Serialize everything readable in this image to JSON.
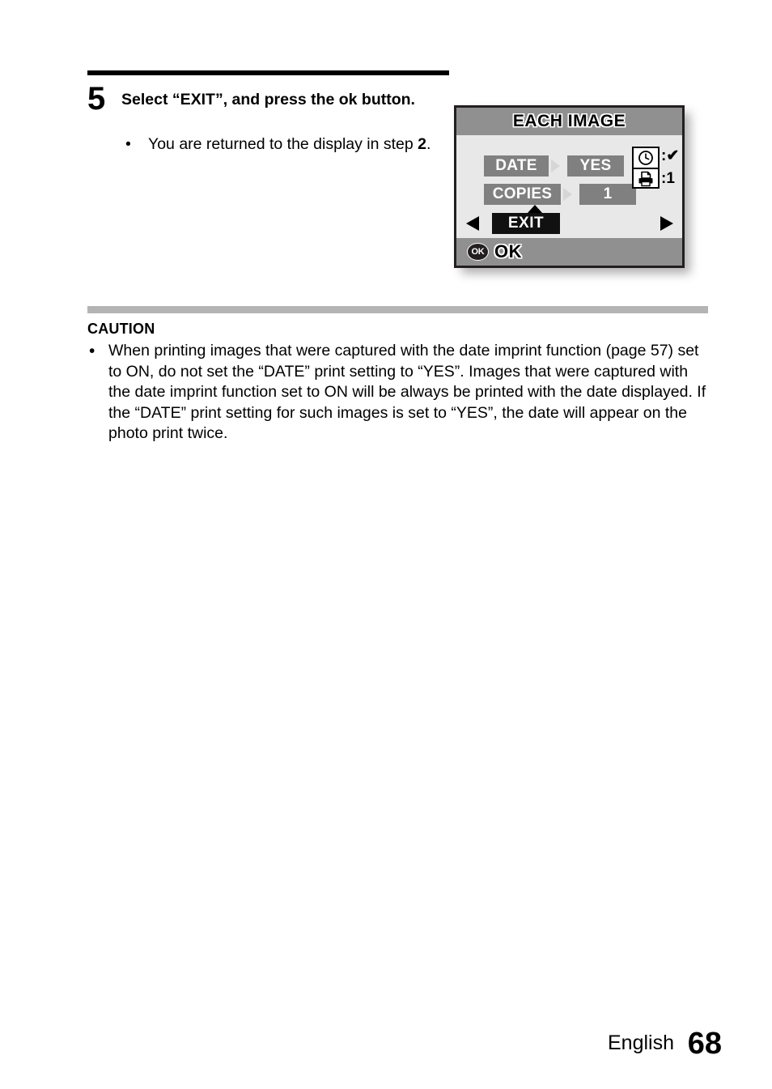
{
  "step": {
    "number": "5",
    "heading": "Select “EXIT”, and press the ok button.",
    "bullet_marker": "•",
    "bullet_text_before": "You are returned to the display in step ",
    "bullet_bold": "2",
    "bullet_text_after": "."
  },
  "lcd": {
    "title": "EACH IMAGE",
    "rows": [
      {
        "label": "DATE",
        "value": "YES",
        "arrow": "chip-arrow-right-icon"
      },
      {
        "label": "COPIES",
        "value": "1",
        "arrow": "chip-arrow-right-icon"
      }
    ],
    "exit_label": "EXIT",
    "left_arrow": "◀",
    "right_arrow": "▶",
    "up_caret": "▲",
    "status_icons": [
      {
        "icon": "clock-icon",
        "value": ":✔"
      },
      {
        "icon": "printer-icon",
        "value": ":1"
      }
    ],
    "footer_badge": "OK",
    "footer_label": "OK"
  },
  "caution": {
    "title": "CAUTION",
    "bullet_marker": "•",
    "text": "When printing images that were captured with the date imprint function (page 57) set to ON, do not set the “DATE” print setting to “YES”. Images that were captured with the date imprint function set to ON will be always be printed with the date displayed. If the “DATE” print setting for such images is set to “YES”, the date will appear on the photo print twice."
  },
  "footer": {
    "language": "English",
    "page_number": "68"
  },
  "colors": {
    "lcd_border": "#231f20",
    "lcd_titlebar": "#909090",
    "lcd_body": "#e8e8e8",
    "chip_gray": "#808080",
    "highlight_black": "#111111",
    "divider_gray": "#b4b4b4"
  }
}
